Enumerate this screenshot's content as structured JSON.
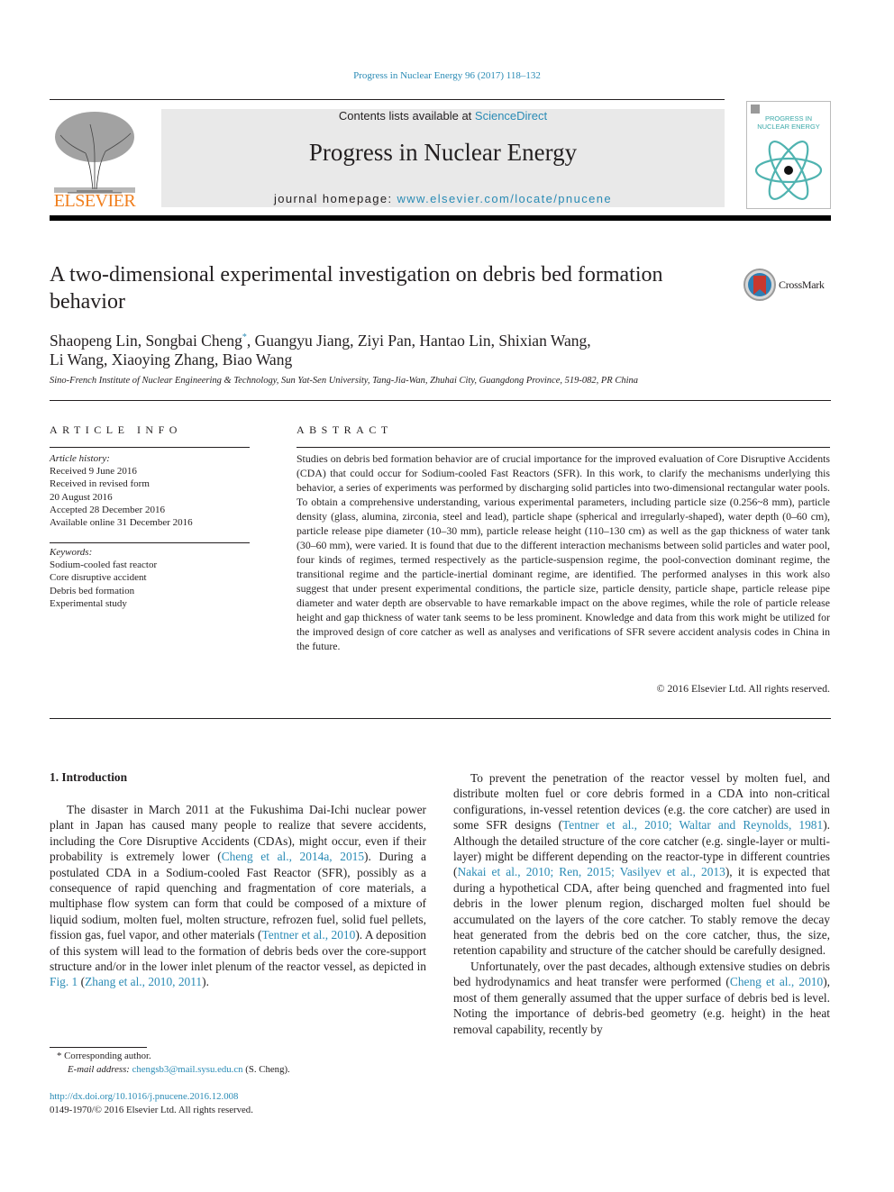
{
  "journal_reference": "Progress in Nuclear Energy 96 (2017) 118–132",
  "header": {
    "publisher_name": "ELSEVIER",
    "contents_prefix": "Contents lists available at ",
    "contents_link": "ScienceDirect",
    "journal_title": "Progress in Nuclear Energy",
    "homepage_prefix": "journal homepage: ",
    "homepage_link": "www.elsevier.com/locate/pnucene",
    "cover_title_line1": "PROGRESS IN",
    "cover_title_line2": "NUCLEAR ENERGY"
  },
  "article": {
    "title": "A two-dimensional experimental investigation on debris bed formation behavior",
    "crossmark_label": "CrossMark",
    "authors_line1_a": "Shaopeng Lin, Songbai Cheng",
    "authors_marker": "*",
    "authors_line1_b": ", Guangyu Jiang, Ziyi Pan, Hantao Lin, Shixian Wang,",
    "authors_line2": "Li Wang, Xiaoying Zhang, Biao Wang",
    "affiliation": "Sino-French Institute of Nuclear Engineering & Technology, Sun Yat-Sen University, Tang-Jia-Wan, Zhuhai City, Guangdong Province, 519-082, PR China"
  },
  "article_info": {
    "heading": "ARTICLE INFO",
    "history_label": "Article history:",
    "history": [
      "Received 9 June 2016",
      "Received in revised form",
      "20 August 2016",
      "Accepted 28 December 2016",
      "Available online 31 December 2016"
    ],
    "keywords_label": "Keywords:",
    "keywords": [
      "Sodium-cooled fast reactor",
      "Core disruptive accident",
      "Debris bed formation",
      "Experimental study"
    ]
  },
  "abstract": {
    "heading": "ABSTRACT",
    "text": "Studies on debris bed formation behavior are of crucial importance for the improved evaluation of Core Disruptive Accidents (CDA) that could occur for Sodium-cooled Fast Reactors (SFR). In this work, to clarify the mechanisms underlying this behavior, a series of experiments was performed by discharging solid particles into two-dimensional rectangular water pools. To obtain a comprehensive understanding, various experimental parameters, including particle size (0.256~8 mm), particle density (glass, alumina, zirconia, steel and lead), particle shape (spherical and irregularly-shaped), water depth (0–60 cm), particle release pipe diameter (10–30 mm), particle release height (110–130 cm) as well as the gap thickness of water tank (30–60 mm), were varied. It is found that due to the different interaction mechanisms between solid particles and water pool, four kinds of regimes, termed respectively as the particle-suspension regime, the pool-convection dominant regime, the transitional regime and the particle-inertial dominant regime, are identified. The performed analyses in this work also suggest that under present experimental conditions, the particle size, particle density, particle shape, particle release pipe diameter and water depth are observable to have remarkable impact on the above regimes, while the role of particle release height and gap thickness of water tank seems to be less prominent. Knowledge and data from this work might be utilized for the improved design of core catcher as well as analyses and verifications of SFR severe accident analysis codes in China in the future.",
    "copyright": "© 2016 Elsevier Ltd. All rights reserved."
  },
  "introduction": {
    "heading": "1.  Introduction",
    "p1": [
      {
        "t": "The disaster in March 2011 at the Fukushima Dai-Ichi nuclear power plant in Japan has caused many people to realize that severe accidents, including the Core Disruptive Accidents (CDAs), might occur, even if their probability is extremely lower ("
      },
      {
        "link": "Cheng et al., 2014a, 2015"
      },
      {
        "t": "). During a postulated CDA in a Sodium-cooled Fast Reactor (SFR), possibly as a consequence of rapid quenching and fragmentation of core materials, a multiphase flow system can form that could be composed of a mixture of liquid sodium, molten fuel, molten structure, refrozen fuel, solid fuel pellets, fission gas, fuel vapor, and other materials ("
      },
      {
        "link": "Tentner et al., 2010"
      },
      {
        "t": "). A deposition of this system will lead to the formation of debris beds over the core-support structure and/or in the lower inlet plenum of the reactor vessel, as depicted in "
      },
      {
        "link": "Fig. 1"
      },
      {
        "t": " ("
      },
      {
        "link": "Zhang et al., 2010, 2011"
      },
      {
        "t": ")."
      }
    ],
    "p2": [
      {
        "t": "To prevent the penetration of the reactor vessel by molten fuel, and distribute molten fuel or core debris formed in a CDA into non-critical configurations, in-vessel retention devices (e.g. the core catcher) are used in some SFR designs ("
      },
      {
        "link": "Tentner et al., 2010; Waltar and Reynolds, 1981"
      },
      {
        "t": "). Although the detailed structure of the core catcher (e.g. single-layer or multi-layer) might be different depending on the reactor-type in different countries ("
      },
      {
        "link": "Nakai et al., 2010; Ren, 2015; Vasilyev et al., 2013"
      },
      {
        "t": "), it is expected that during a hypothetical CDA, after being quenched and fragmented into fuel debris in the lower plenum region, discharged molten fuel should be accumulated on the layers of the core catcher. To stably remove the decay heat generated from the debris bed on the core catcher, thus, the size, retention capability and structure of the catcher should be carefully designed."
      }
    ],
    "p3": [
      {
        "t": "Unfortunately, over the past decades, although extensive studies on debris bed hydrodynamics and heat transfer were performed ("
      },
      {
        "link": "Cheng et al., 2010"
      },
      {
        "t": "), most of them generally assumed that the upper surface of debris bed is level. Noting the importance of debris-bed geometry (e.g. height) in the heat removal capability, recently by"
      }
    ]
  },
  "footnote": {
    "marker": "*",
    "corresponding": "Corresponding author.",
    "email_label": "E-mail address: ",
    "email": "chengsb3@mail.sysu.edu.cn",
    "email_suffix": " (S. Cheng).",
    "doi": "http://dx.doi.org/10.1016/j.pnucene.2016.12.008",
    "issn_copyright": "0149-1970/© 2016 Elsevier Ltd. All rights reserved."
  }
}
